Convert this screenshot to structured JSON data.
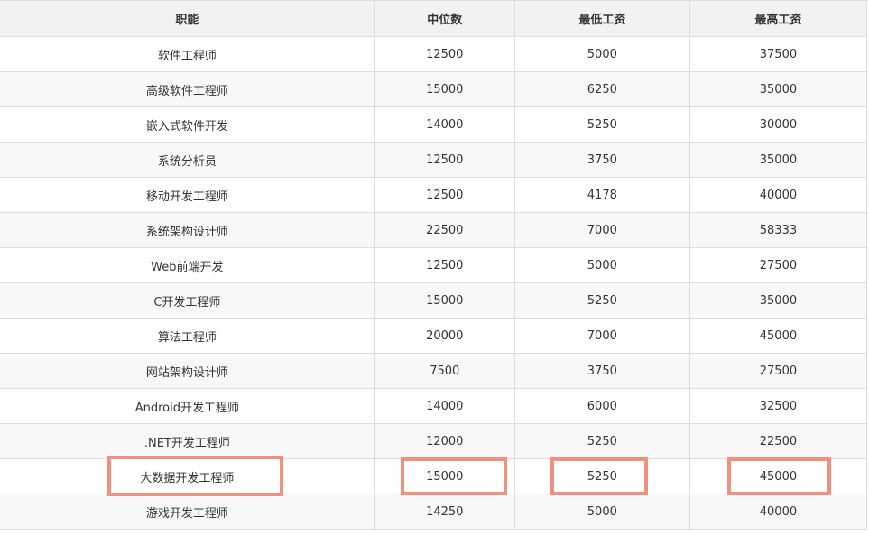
{
  "table": {
    "headers": [
      "职能",
      "中位数",
      "最低工资",
      "最高工资"
    ],
    "rows": [
      [
        "软件工程师",
        "12500",
        "5000",
        "37500"
      ],
      [
        "高级软件工程师",
        "15000",
        "6250",
        "35000"
      ],
      [
        "嵌入式软件开发",
        "14000",
        "5250",
        "30000"
      ],
      [
        "系统分析员",
        "12500",
        "3750",
        "35000"
      ],
      [
        "移动开发工程师",
        "12500",
        "4178",
        "40000"
      ],
      [
        "系统架构设计师",
        "22500",
        "7000",
        "58333"
      ],
      [
        "Web前端开发",
        "12500",
        "5000",
        "27500"
      ],
      [
        "C开发工程师",
        "15000",
        "5250",
        "35000"
      ],
      [
        "算法工程师",
        "20000",
        "7000",
        "45000"
      ],
      [
        "网站架构设计师",
        "7500",
        "3750",
        "27500"
      ],
      [
        "Android开发工程师",
        "14000",
        "6000",
        "32500"
      ],
      [
        ".NET开发工程师",
        "12000",
        "5250",
        "22500"
      ],
      [
        "大数据开发工程师",
        "15000",
        "5250",
        "45000"
      ],
      [
        "游戏开发工程师",
        "14250",
        "5000",
        "40000"
      ]
    ]
  },
  "highlight": {
    "row_index": 12,
    "color": "#f3907c"
  }
}
